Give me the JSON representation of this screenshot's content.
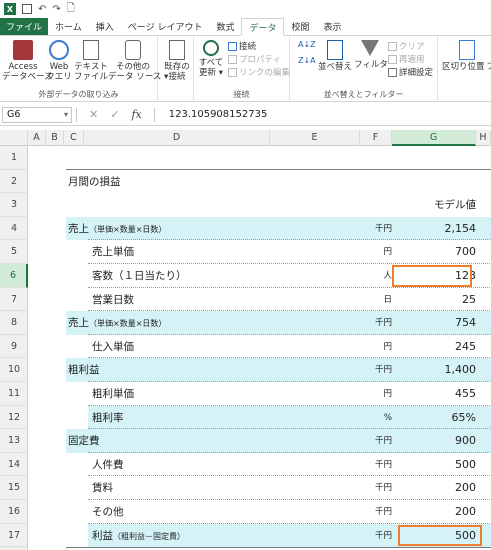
{
  "qat": {
    "logo": "X",
    "undo_icon": "↶",
    "redo_icon": "↷",
    "preview_icon": "🗋"
  },
  "tabs": [
    "ファイル",
    "ホーム",
    "挿入",
    "ページ レイアウト",
    "数式",
    "データ",
    "校閲",
    "表示"
  ],
  "active_tab": "データ",
  "ribbon": {
    "external_group": {
      "label": "外部データの取り込み",
      "buttons": [
        {
          "line1": "Access",
          "line2": "データベース"
        },
        {
          "line1": "Web",
          "line2": "クエリ"
        },
        {
          "line1": "テキスト",
          "line2": "ファイル"
        },
        {
          "line1": "その他の",
          "line2": "データ ソース ▾"
        },
        {
          "line1": "既存の",
          "line2": "接続"
        }
      ]
    },
    "connections_group": {
      "label": "接続",
      "refresh_line1": "すべて",
      "refresh_line2": "更新 ▾",
      "items": [
        "接続",
        "プロパティ",
        "リンクの編集"
      ]
    },
    "sort_group": {
      "label": "並べ替えとフィルター",
      "sort_label": "並べ替え",
      "filter_label": "フィルター",
      "items": [
        "クリア",
        "再適用",
        "詳細設定"
      ]
    },
    "tools": {
      "line1": "区切り位置",
      "line2": "フ"
    }
  },
  "formula_bar": {
    "name_box": "G6",
    "cancel_icon": "✕",
    "enter_icon": "✓",
    "fx": "fx",
    "value": "123.105908152735"
  },
  "columns": [
    "A",
    "B",
    "C",
    "D",
    "E",
    "F",
    "G",
    "H"
  ],
  "selected_column": "G",
  "rows": [
    "1",
    "2",
    "3",
    "4",
    "5",
    "6",
    "7",
    "8",
    "9",
    "10",
    "11",
    "12",
    "13",
    "14",
    "15",
    "16",
    "17"
  ],
  "selected_row": "6",
  "sheet": {
    "title": "月間の損益",
    "header_model": "モデル値",
    "lines": [
      {
        "label": "売上",
        "sub": "（単価×数量×日数）",
        "unit": "千円",
        "value": "2,154"
      },
      {
        "label": "売上単価",
        "sub": "",
        "unit": "円",
        "value": "700"
      },
      {
        "label": "客数（１日当たり）",
        "sub": "",
        "unit": "人",
        "value": "123"
      },
      {
        "label": "営業日数",
        "sub": "",
        "unit": "日",
        "value": "25"
      },
      {
        "label": "売上",
        "sub": "（単価×数量×日数）",
        "unit": "千円",
        "value": "754"
      },
      {
        "label": "仕入単価",
        "sub": "",
        "unit": "円",
        "value": "245"
      },
      {
        "label": "粗利益",
        "sub": "",
        "unit": "千円",
        "value": "1,400"
      },
      {
        "label": "粗利単価",
        "sub": "",
        "unit": "円",
        "value": "455"
      },
      {
        "label": "粗利率",
        "sub": "",
        "unit": "%",
        "value": "65%"
      },
      {
        "label": "固定費",
        "sub": "",
        "unit": "千円",
        "value": "900"
      },
      {
        "label": "人件費",
        "sub": "",
        "unit": "千円",
        "value": "500"
      },
      {
        "label": "賃料",
        "sub": "",
        "unit": "千円",
        "value": "200"
      },
      {
        "label": "その他",
        "sub": "",
        "unit": "千円",
        "value": "200"
      },
      {
        "label": "利益",
        "sub": "（粗利益－固定費）",
        "unit": "千円",
        "value": "500"
      }
    ]
  },
  "colors": {
    "accent": "#217346",
    "cyan": "#d5f2f7",
    "highlight": "#ed7d31"
  }
}
